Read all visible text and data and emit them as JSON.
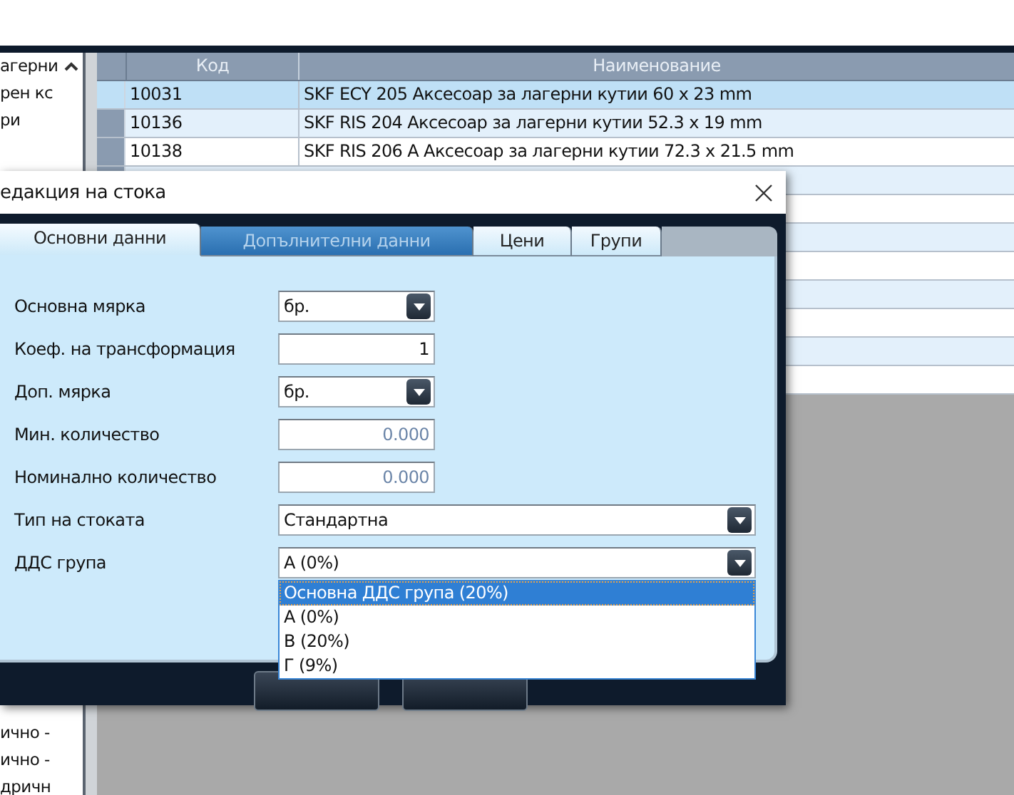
{
  "side_list": {
    "items_top": [
      "агерни",
      "рен кс",
      "ри"
    ],
    "items_bottom": [
      "ично -",
      "ично -",
      "дричн"
    ]
  },
  "table": {
    "columns": [
      "Код",
      "Наименование"
    ],
    "rows": [
      {
        "code": "10031",
        "name": "SKF ECY 205 Аксесоар за лагерни кутии 60 x 23 mm",
        "selected": true
      },
      {
        "code": "10136",
        "name": "SKF RIS 204 Аксесоар за лагерни кутии 52.3 x 19 mm",
        "selected": false
      },
      {
        "code": "10138",
        "name": "SKF RIS 206 A Аксесоар за лагерни кутии 72.3 x 21.5 mm",
        "selected": false
      }
    ]
  },
  "dialog": {
    "title": "едакция на стока",
    "tabs": [
      {
        "label": "Основни данни",
        "selected": true,
        "disabled": false
      },
      {
        "label": "Допълнителни данни",
        "selected": false,
        "disabled": true
      },
      {
        "label": "Цени",
        "selected": false,
        "disabled": false
      },
      {
        "label": "Групи",
        "selected": false,
        "disabled": false
      }
    ],
    "fields": [
      {
        "label": "Основна мярка",
        "kind": "combo",
        "value": "бр."
      },
      {
        "label": "Коеф. на трансформация",
        "kind": "number",
        "value": "1"
      },
      {
        "label": "Доп. мярка",
        "kind": "combo",
        "value": "бр."
      },
      {
        "label": "Мин. количество",
        "kind": "number",
        "value": "0.000"
      },
      {
        "label": "Номинално количество",
        "kind": "number",
        "value": "0.000"
      },
      {
        "label": "Тип на стоката",
        "kind": "wide_combo",
        "value": "Стандартна"
      },
      {
        "label": "ДДС група",
        "kind": "wide_combo",
        "value": "А (0%)"
      }
    ],
    "dropdown": [
      {
        "label": "Основна ДДС група (20%)",
        "selected": true
      },
      {
        "label": "А (0%)",
        "selected": false
      },
      {
        "label": "В (20%)",
        "selected": false
      },
      {
        "label": "Г (9%)",
        "selected": false
      }
    ]
  }
}
